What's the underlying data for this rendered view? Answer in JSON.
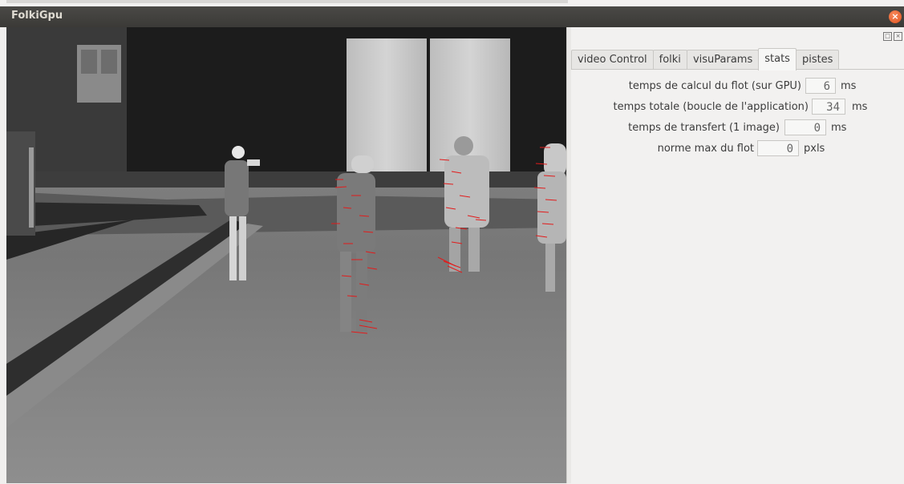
{
  "window": {
    "title": "FolkiGpu",
    "close_glyph": "×"
  },
  "video": {
    "description_alt": "Thermal camera frame with optical flow vectors",
    "flow_color": "#e21b1b"
  },
  "panel": {
    "float_icons": [
      "□",
      "×"
    ],
    "tabs": [
      {
        "label": "video Control",
        "active": false
      },
      {
        "label": "folki",
        "active": false
      },
      {
        "label": "visuParams",
        "active": false
      },
      {
        "label": "stats",
        "active": true
      },
      {
        "label": "pistes",
        "active": false
      }
    ],
    "stats": [
      {
        "label": "temps de calcul du flot (sur GPU)",
        "value": "6",
        "unit": "ms"
      },
      {
        "label": "temps totale (boucle de l'application)",
        "value": "34",
        "unit": "ms"
      },
      {
        "label": "temps de transfert (1 image)",
        "value": "0",
        "unit": "ms"
      },
      {
        "label": "norme max du flot",
        "value": "0",
        "unit": "pxls"
      }
    ]
  }
}
